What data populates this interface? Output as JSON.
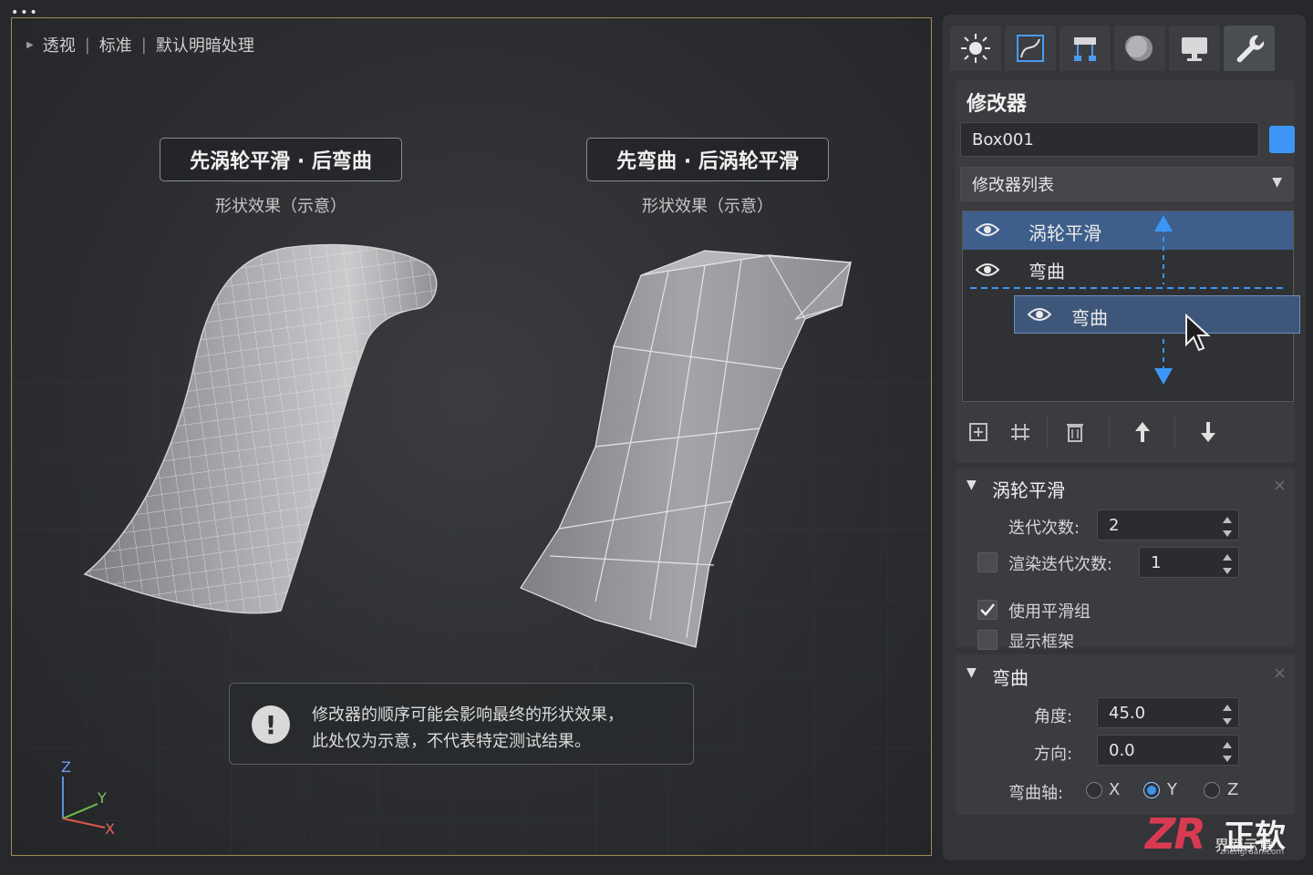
{
  "viewport": {
    "label_items": [
      "透视",
      "标准",
      "默认明暗处理"
    ],
    "left_title": "先涡轮平滑 · 后弯曲",
    "left_subtitle": "形状效果（示意）",
    "right_title": "先弯曲 · 后涡轮平滑",
    "right_subtitle": "形状效果（示意）",
    "notice_icon": "!",
    "notice_line1": "修改器的顺序可能会影响最终的形状效果，",
    "notice_line2": "此处仅为示意，不代表特定测试结果。",
    "axis_z": "Z",
    "axis_y": "Y",
    "axis_x": "X"
  },
  "panel": {
    "tabs": [
      "sun-icon",
      "curve-select-icon",
      "hierarchy-icon",
      "sphere-icon",
      "monitor-icon",
      "wrench-icon"
    ],
    "active_tab": "wrench-icon",
    "header": "修改器",
    "object_name": "Box001",
    "object_color": "#3d96f5",
    "modifier_list": "修改器列表",
    "stack": [
      {
        "label": "涡轮平滑",
        "visible": true,
        "selected": true
      },
      {
        "label": "弯曲",
        "visible": true,
        "selected": false
      }
    ],
    "drag_item": "弯曲",
    "stack_tools": [
      "pin-stack-icon",
      "configure-sets-icon",
      "delete-icon",
      "move-up-icon",
      "move-down-icon"
    ],
    "turbosmooth": {
      "title": "涡轮平滑",
      "iterations_label": "迭代次数:",
      "iterations_value": "2",
      "render_iters_label": "渲染迭代次数:",
      "render_iters_value": "1",
      "render_iters_checked": false,
      "smoothing_label": "使用平滑组",
      "smoothing_checked": true,
      "isoline_label": "显示框架",
      "isoline_checked": false
    },
    "bend": {
      "title": "弯曲",
      "angle_label": "角度:",
      "angle_value": "45.0",
      "direction_label": "方向:",
      "direction_value": "0.0",
      "axis_label": "弯曲轴:",
      "axis_options": [
        "X",
        "Y",
        "Z"
      ],
      "axis_selected": "Y"
    }
  },
  "watermark": {
    "logo": "ZR",
    "brand": "正软",
    "caption": "界面示意",
    "url": "zhengruan.com"
  },
  "colors": {
    "accent": "#3d96f5",
    "viewport_border": "#a08a52",
    "panel_bg": "#333538"
  }
}
